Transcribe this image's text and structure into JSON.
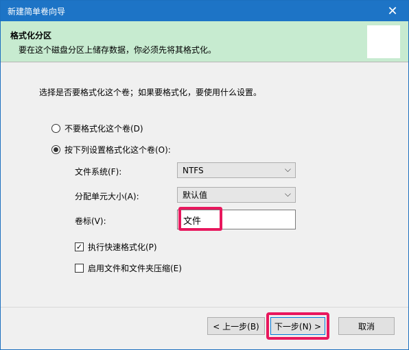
{
  "window": {
    "title": "新建简单卷向导",
    "close_glyph": "✕"
  },
  "header": {
    "title": "格式化分区",
    "subtitle": "要在这个磁盘分区上储存数据，你必须先将其格式化。"
  },
  "main": {
    "intro": "选择是否要格式化这个卷；如果要格式化，要使用什么设置。",
    "options": [
      {
        "label": "不要格式化这个卷(D)",
        "checked": false
      },
      {
        "label": "按下列设置格式化这个卷(O):",
        "checked": true
      }
    ],
    "fields": {
      "filesystem_label": "文件系统(F):",
      "filesystem_value": "NTFS",
      "unit_label": "分配单元大小(A):",
      "unit_value": "默认值",
      "volume_label": "卷标(V):",
      "volume_value": "文件"
    },
    "checks": [
      {
        "label": "执行快速格式化(P)",
        "checked": true,
        "mark": "✓"
      },
      {
        "label": "启用文件和文件夹压缩(E)",
        "checked": false,
        "mark": ""
      }
    ]
  },
  "footer": {
    "back_label": "< 上一步(B)",
    "next_label": "下一步(N) >",
    "cancel_label": "取消"
  },
  "icons": {
    "chevron": "⌵"
  },
  "colors": {
    "titlebar": "#1d74c6",
    "header_bg": "#c7ebd0",
    "highlight": "#e8175d"
  }
}
